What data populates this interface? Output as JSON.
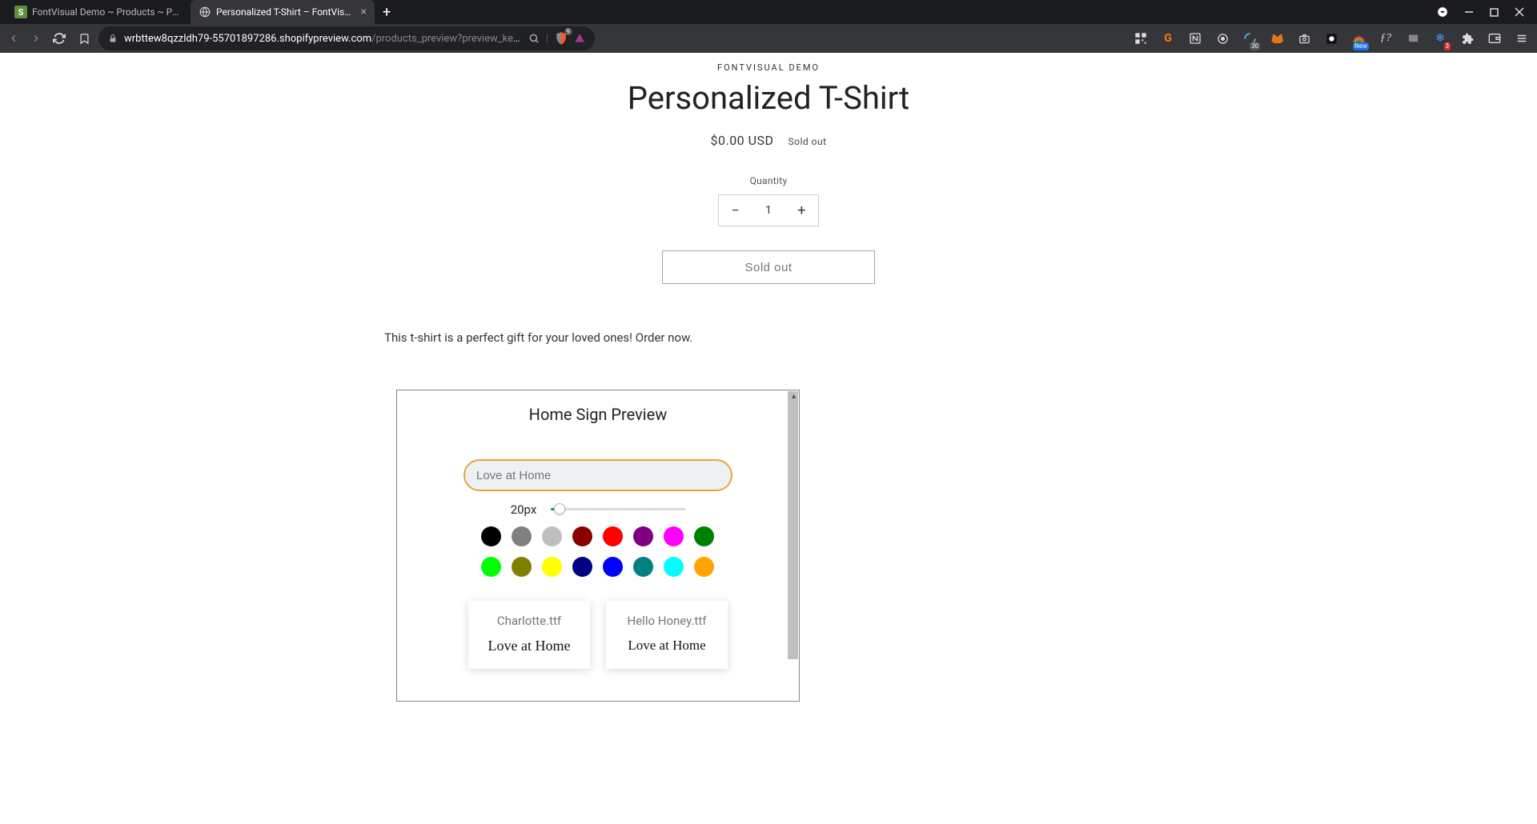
{
  "browser": {
    "tabs": [
      {
        "title": "FontVisual Demo ~ Products ~ Person",
        "active": false
      },
      {
        "title": "Personalized T-Shirt – FontVisual",
        "active": true
      }
    ],
    "url_host": "wrbttew8qzzldh79-55701897286.shopifypreview.com",
    "url_path": "/products_preview?preview_key...",
    "shield_count": "9",
    "ext_badges": {
      "calendar": "30",
      "new": "New",
      "alert": "3"
    }
  },
  "product": {
    "store": "FONTVISUAL DEMO",
    "title": "Personalized T-Shirt",
    "price": "$0.00 USD",
    "sold_out_tag": "Sold out",
    "qty_label": "Quantity",
    "qty_value": "1",
    "sold_out_btn": "Sold out",
    "description": "This t-shirt is a perfect gift for your loved ones! Order now."
  },
  "preview": {
    "title": "Home Sign Preview",
    "input_placeholder": "Love at Home",
    "size_label": "20px",
    "colors": [
      "#000000",
      "#808080",
      "#bfbfbf",
      "#8b0000",
      "#ff0000",
      "#800080",
      "#ff00ff",
      "#008000",
      "#00ff00",
      "#808000",
      "#ffff00",
      "#000080",
      "#0000ff",
      "#008080",
      "#00ffff",
      "#ffa500"
    ],
    "fonts": [
      {
        "name": "Charlotte.ttf",
        "sample": "Love at Home",
        "style": "script"
      },
      {
        "name": "Hello Honey.ttf",
        "sample": "Love at Home",
        "style": "serif"
      }
    ]
  }
}
